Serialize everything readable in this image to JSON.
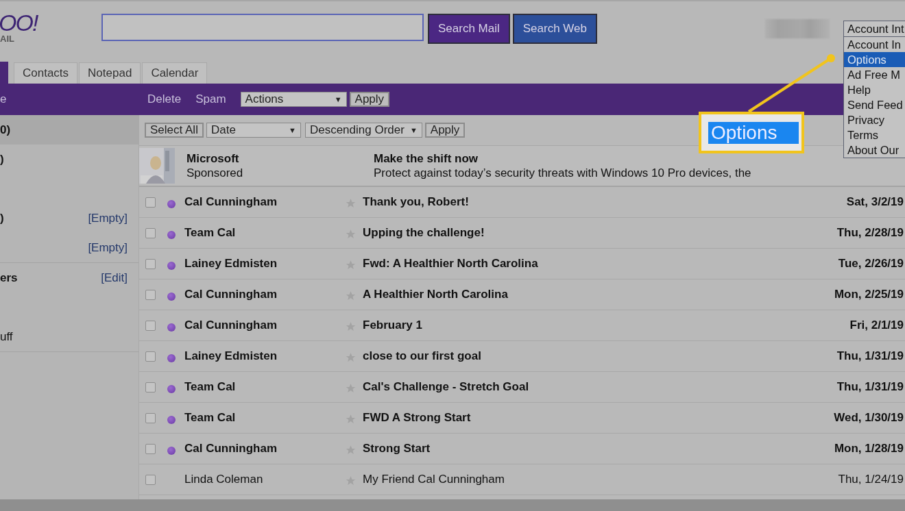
{
  "logo": {
    "text": "OO!",
    "subtext": "AIL"
  },
  "search": {
    "buttons": [
      "Search Mail",
      "Search Web"
    ]
  },
  "account_menu": {
    "value": "Account Int",
    "options": [
      {
        "label": "Account In",
        "selected": false
      },
      {
        "label": "Options",
        "selected": true
      },
      {
        "label": "Ad Free M",
        "selected": false
      },
      {
        "label": "Help",
        "selected": false
      },
      {
        "label": "Send Feed",
        "selected": false
      },
      {
        "label": "Privacy",
        "selected": false
      },
      {
        "label": "Terms",
        "selected": false
      },
      {
        "label": "About Our",
        "selected": false
      }
    ]
  },
  "callout": {
    "label": "Options"
  },
  "tabs": [
    {
      "label": "Contacts",
      "selected": false
    },
    {
      "label": "Notepad",
      "selected": false
    },
    {
      "label": "Calendar",
      "selected": false
    }
  ],
  "toolbar": {
    "title_fragment": "e",
    "actions": [
      "Delete",
      "Spam"
    ],
    "actions_select": "Actions",
    "arrow": "▼",
    "apply": "Apply"
  },
  "sidebar": {
    "sections": [
      {
        "items": [
          {
            "label": "0)",
            "selected": true
          },
          {
            "label": ")",
            "selected": false
          },
          {
            "label": ")",
            "action": "[Empty]",
            "selected": false
          },
          {
            "action": "[Empty]",
            "selected": false
          }
        ]
      },
      {
        "items": [
          {
            "label": "ers",
            "bold": true,
            "action": "[Edit]",
            "selected": false
          },
          {
            "label": "uff",
            "bold": false,
            "selected": false
          }
        ]
      }
    ]
  },
  "sort_bar": {
    "select_all": "Select All",
    "sort_by": "Date",
    "sort_arrow": "▼",
    "order": "Descending Order",
    "order_arrow": "▼",
    "apply": "Apply"
  },
  "ad": {
    "sender": "Microsoft",
    "tag": "Sponsored",
    "subject": "Make the shift now",
    "preview": "Protect against today’s security threats with Windows 10 Pro devices, the"
  },
  "messages": [
    {
      "sender": "Cal Cunningham",
      "subject": "Thank you, Robert!",
      "date": "Sat, 3/2/19",
      "unread": true
    },
    {
      "sender": "Team Cal",
      "subject": "Upping the challenge!",
      "date": "Thu, 2/28/19",
      "unread": true
    },
    {
      "sender": "Lainey Edmisten",
      "subject": "Fwd: A Healthier North Carolina",
      "date": "Tue, 2/26/19",
      "unread": true
    },
    {
      "sender": "Cal Cunningham",
      "subject": "A Healthier North Carolina",
      "date": "Mon, 2/25/19",
      "unread": true
    },
    {
      "sender": "Cal Cunningham",
      "subject": "February 1",
      "date": "Fri, 2/1/19",
      "unread": true
    },
    {
      "sender": "Lainey Edmisten",
      "subject": "close to our first goal",
      "date": "Thu, 1/31/19",
      "unread": true
    },
    {
      "sender": "Team Cal",
      "subject": "Cal's Challenge - Stretch Goal",
      "date": "Thu, 1/31/19",
      "unread": true
    },
    {
      "sender": "Team Cal",
      "subject": "FWD A Strong Start",
      "date": "Wed, 1/30/19",
      "unread": true
    },
    {
      "sender": "Cal Cunningham",
      "subject": "Strong Start",
      "date": "Mon, 1/28/19",
      "unread": true
    },
    {
      "sender": "Linda Coleman",
      "subject": "My Friend Cal Cunningham",
      "date": "Thu, 1/24/19",
      "unread": false
    }
  ]
}
